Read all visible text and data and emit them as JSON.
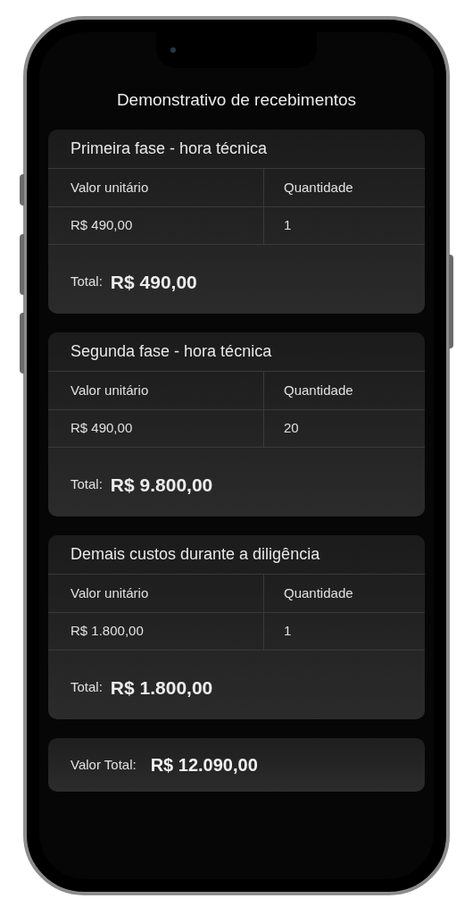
{
  "title": "Demonstrativo de recebimentos",
  "sections": [
    {
      "title": "Primeira fase - hora técnica",
      "columns": [
        "Valor unitário",
        "Quantidade"
      ],
      "row": [
        "R$ 490,00",
        "1"
      ],
      "total_label": "Total:",
      "total": "R$ 490,00"
    },
    {
      "title": "Segunda fase - hora técnica",
      "columns": [
        "Valor unitário",
        "Quantidade"
      ],
      "row": [
        "R$ 490,00",
        "20"
      ],
      "total_label": "Total:",
      "total": "R$ 9.800,00"
    },
    {
      "title": "Demais custos durante a diligência",
      "columns": [
        "Valor unitário",
        "Quantidade"
      ],
      "row": [
        "R$ 1.800,00",
        "1"
      ],
      "total_label": "Total:",
      "total": "R$ 1.800,00"
    }
  ],
  "grand_total": {
    "label": "Valor Total:",
    "value": "R$ 12.090,00"
  }
}
